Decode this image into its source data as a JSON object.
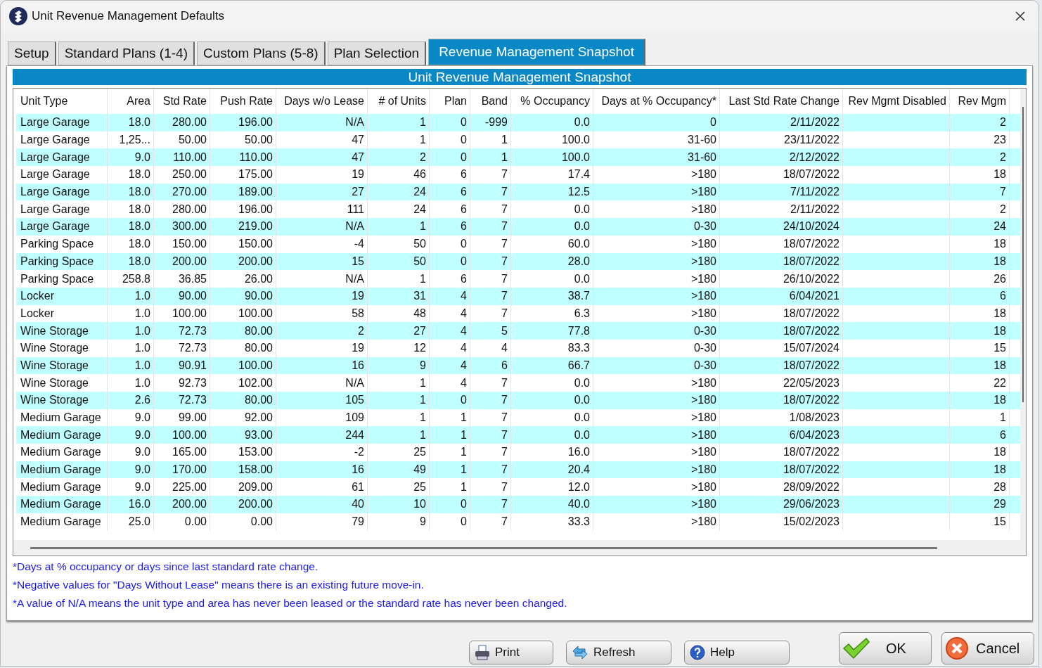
{
  "window": {
    "title": "Unit Revenue Management Defaults"
  },
  "tabs": [
    {
      "label": "Setup",
      "selected": false
    },
    {
      "label": "Standard Plans (1-4)",
      "selected": false
    },
    {
      "label": "Custom Plans (5-8)",
      "selected": false
    },
    {
      "label": "Plan Selection",
      "selected": false
    },
    {
      "label": "Revenue Management Snapshot",
      "selected": true
    }
  ],
  "panel_title": "Unit Revenue Management Snapshot",
  "table": {
    "columns": [
      "Unit Type",
      "Area",
      "Std Rate",
      "Push Rate",
      "Days w/o Lease",
      "# of Units",
      "Plan",
      "Band",
      "% Occupancy",
      "Days at % Occupancy*",
      "Last Std Rate Change",
      "Rev Mgmt Disabled",
      "Rev Mgm"
    ],
    "rows": [
      [
        "Large Garage",
        "18.0",
        "280.00",
        "196.00",
        "N/A",
        "1",
        "0",
        "-999",
        "0.0",
        "0",
        "2/11/2022",
        "",
        "2"
      ],
      [
        "Large Garage",
        "1,25...",
        "50.00",
        "50.00",
        "47",
        "1",
        "0",
        "1",
        "100.0",
        "31-60",
        "23/11/2022",
        "",
        "23"
      ],
      [
        "Large Garage",
        "9.0",
        "110.00",
        "110.00",
        "47",
        "2",
        "0",
        "1",
        "100.0",
        "31-60",
        "2/12/2022",
        "",
        "2"
      ],
      [
        "Large Garage",
        "18.0",
        "250.00",
        "175.00",
        "19",
        "46",
        "6",
        "7",
        "17.4",
        ">180",
        "18/07/2022",
        "",
        "18"
      ],
      [
        "Large Garage",
        "18.0",
        "270.00",
        "189.00",
        "27",
        "24",
        "6",
        "7",
        "12.5",
        ">180",
        "7/11/2022",
        "",
        "7"
      ],
      [
        "Large Garage",
        "18.0",
        "280.00",
        "196.00",
        "111",
        "24",
        "6",
        "7",
        "0.0",
        ">180",
        "2/11/2022",
        "",
        "2"
      ],
      [
        "Large Garage",
        "18.0",
        "300.00",
        "219.00",
        "N/A",
        "1",
        "6",
        "7",
        "0.0",
        "0-30",
        "24/10/2024",
        "",
        "24"
      ],
      [
        "Parking Space",
        "18.0",
        "150.00",
        "150.00",
        "-4",
        "50",
        "0",
        "7",
        "60.0",
        ">180",
        "18/07/2022",
        "",
        "18"
      ],
      [
        "Parking Space",
        "18.0",
        "200.00",
        "200.00",
        "15",
        "50",
        "0",
        "7",
        "28.0",
        ">180",
        "18/07/2022",
        "",
        "18"
      ],
      [
        "Parking Space",
        "258.8",
        "36.85",
        "26.00",
        "N/A",
        "1",
        "6",
        "7",
        "0.0",
        ">180",
        "26/10/2022",
        "",
        "26"
      ],
      [
        "Locker",
        "1.0",
        "90.00",
        "90.00",
        "19",
        "31",
        "4",
        "7",
        "38.7",
        ">180",
        "6/04/2021",
        "",
        "6"
      ],
      [
        "Locker",
        "1.0",
        "100.00",
        "100.00",
        "58",
        "48",
        "4",
        "7",
        "6.3",
        ">180",
        "18/07/2022",
        "",
        "18"
      ],
      [
        "Wine Storage",
        "1.0",
        "72.73",
        "80.00",
        "2",
        "27",
        "4",
        "5",
        "77.8",
        "0-30",
        "18/07/2022",
        "",
        "18"
      ],
      [
        "Wine Storage",
        "1.0",
        "72.73",
        "80.00",
        "19",
        "12",
        "4",
        "4",
        "83.3",
        "0-30",
        "15/07/2024",
        "",
        "15"
      ],
      [
        "Wine Storage",
        "1.0",
        "90.91",
        "100.00",
        "16",
        "9",
        "4",
        "6",
        "66.7",
        "0-30",
        "18/07/2022",
        "",
        "18"
      ],
      [
        "Wine Storage",
        "1.0",
        "92.73",
        "102.00",
        "N/A",
        "1",
        "4",
        "7",
        "0.0",
        ">180",
        "22/05/2023",
        "",
        "22"
      ],
      [
        "Wine Storage",
        "2.6",
        "72.73",
        "80.00",
        "105",
        "1",
        "0",
        "7",
        "0.0",
        ">180",
        "18/07/2022",
        "",
        "18"
      ],
      [
        "Medium Garage",
        "9.0",
        "99.00",
        "92.00",
        "109",
        "1",
        "1",
        "7",
        "0.0",
        ">180",
        "1/08/2023",
        "",
        "1"
      ],
      [
        "Medium Garage",
        "9.0",
        "100.00",
        "93.00",
        "244",
        "1",
        "1",
        "7",
        "0.0",
        ">180",
        "6/04/2023",
        "",
        "6"
      ],
      [
        "Medium Garage",
        "9.0",
        "165.00",
        "153.00",
        "-2",
        "25",
        "1",
        "7",
        "16.0",
        ">180",
        "18/07/2022",
        "",
        "18"
      ],
      [
        "Medium Garage",
        "9.0",
        "170.00",
        "158.00",
        "16",
        "49",
        "1",
        "7",
        "20.4",
        ">180",
        "18/07/2022",
        "",
        "18"
      ],
      [
        "Medium Garage",
        "9.0",
        "225.00",
        "209.00",
        "61",
        "25",
        "1",
        "7",
        "12.0",
        ">180",
        "28/09/2022",
        "",
        "28"
      ],
      [
        "Medium Garage",
        "16.0",
        "200.00",
        "200.00",
        "40",
        "10",
        "0",
        "7",
        "40.0",
        ">180",
        "29/06/2023",
        "",
        "29"
      ],
      [
        "Medium Garage",
        "25.0",
        "0.00",
        "0.00",
        "79",
        "9",
        "0",
        "7",
        "33.3",
        ">180",
        "15/02/2023",
        "",
        "15"
      ]
    ]
  },
  "notes": [
    "*Days at % occupancy or days since last standard rate change.",
    "*Negative values for \"Days Without Lease\" means there is an existing future move-in.",
    "*A value of N/A means the unit type and area has never been leased or the standard rate has never been changed."
  ],
  "buttons": [
    {
      "label": "Print",
      "kind": "print"
    },
    {
      "label": "Refresh",
      "kind": "refresh"
    },
    {
      "label": "Help",
      "kind": "help"
    },
    {
      "label": "OK",
      "kind": "ok"
    },
    {
      "label": "Cancel",
      "kind": "cancel"
    }
  ]
}
